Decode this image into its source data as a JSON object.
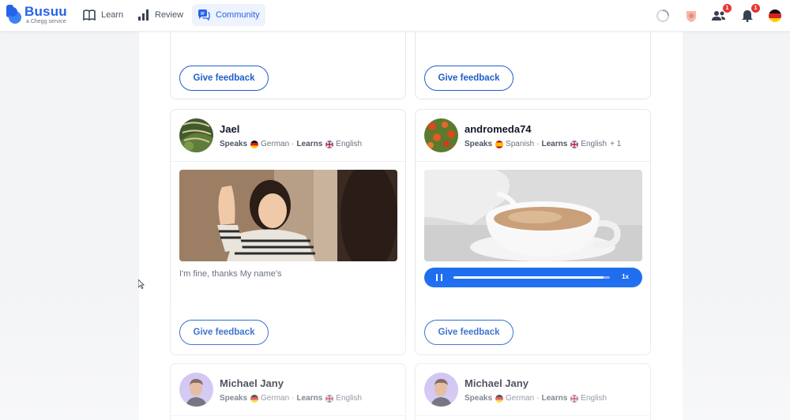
{
  "brand": {
    "name": "Busuu",
    "tagline": "a Chegg service",
    "color": "#2563eb"
  },
  "nav": {
    "items": [
      {
        "label": "Learn",
        "icon": "book-icon"
      },
      {
        "label": "Review",
        "icon": "bar-chart-icon"
      },
      {
        "label": "Community",
        "icon": "chat-icon",
        "active": true
      }
    ]
  },
  "header_icons": {
    "friends_badge": "1",
    "notifications_badge": "1"
  },
  "cards": {
    "top_left": {
      "button": "Give feedback"
    },
    "top_right": {
      "button": "Give feedback"
    },
    "jael": {
      "name": "Jael",
      "speaks_label": "Speaks",
      "speaks": "German",
      "learns_label": "Learns",
      "learns": "English",
      "answer": "I'm fine, thanks My name's",
      "button": "Give feedback"
    },
    "andromeda": {
      "name": "andromeda74",
      "speaks_label": "Speaks",
      "speaks": "Spanish",
      "learns_label": "Learns",
      "learns": "English",
      "extra": "+ 1",
      "audio": {
        "speed": "1x",
        "progress": 0.96
      },
      "button": "Give feedback"
    },
    "michael_left": {
      "name": "Michael Jany",
      "speaks_label": "Speaks",
      "speaks": "German",
      "learns_label": "Learns",
      "learns": "English"
    },
    "michael_right": {
      "name": "Michael Jany",
      "speaks_label": "Speaks",
      "speaks": "German",
      "learns_label": "Learns",
      "learns": "English"
    }
  }
}
